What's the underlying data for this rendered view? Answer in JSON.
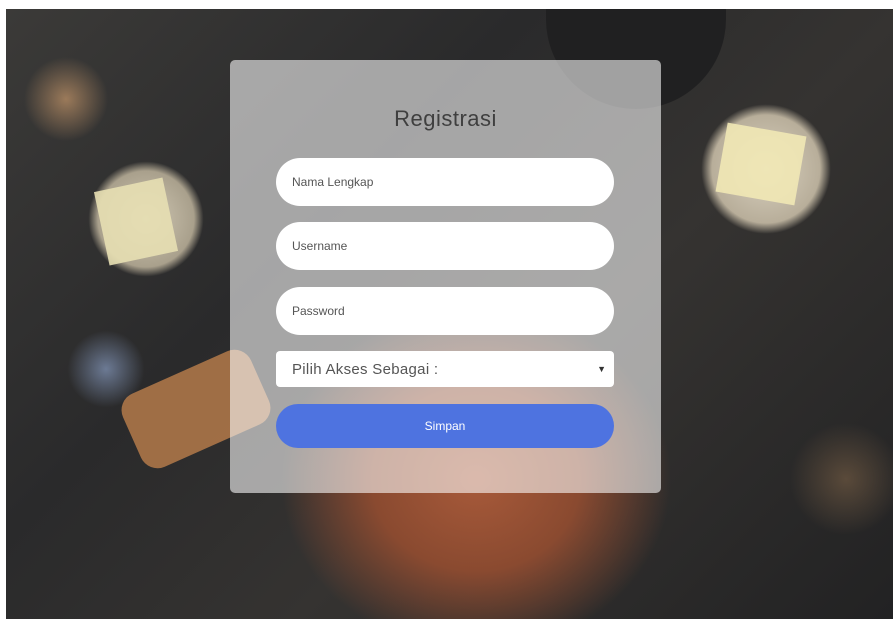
{
  "form": {
    "title": "Registrasi",
    "fields": {
      "full_name_placeholder": "Nama Lengkap",
      "username_placeholder": "Username",
      "password_placeholder": "Password"
    },
    "access_select": {
      "selected": "Pilih Akses Sebagai :"
    },
    "submit_label": "Simpan"
  },
  "colors": {
    "accent": "#4e73e0",
    "card": "rgba(255,255,255,0.58)"
  },
  "icons": {
    "select_arrow": "chevron-down-icon"
  }
}
